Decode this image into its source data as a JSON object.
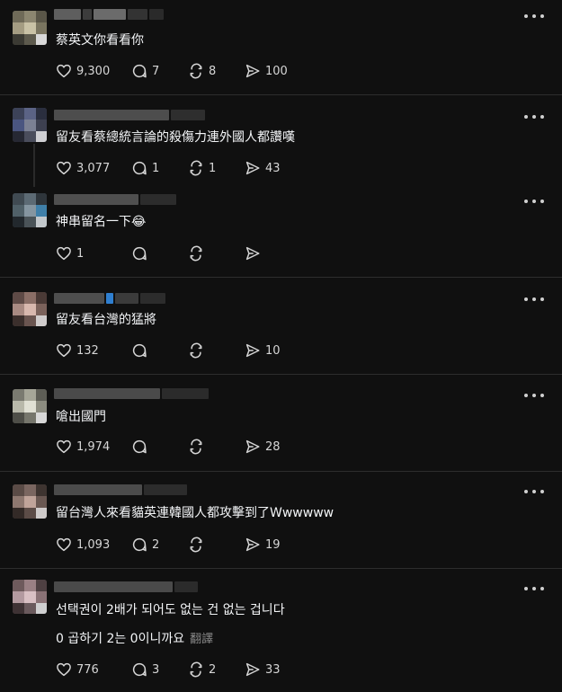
{
  "posts": [
    {
      "text": "蔡英文你看看你",
      "likes": "9,300",
      "comments": "7",
      "reposts": "8",
      "shares": "100"
    },
    {
      "text": "留友看蔡總統言論的殺傷力連外國人都讚嘆",
      "likes": "3,077",
      "comments": "1",
      "reposts": "1",
      "shares": "43"
    },
    {
      "text": "神串留名一下😂",
      "likes": "1",
      "comments": "",
      "reposts": "",
      "shares": ""
    },
    {
      "text": "留友看台灣的猛將",
      "likes": "132",
      "comments": "",
      "reposts": "",
      "shares": "10"
    },
    {
      "text": "嗆出國門",
      "likes": "1,974",
      "comments": "",
      "reposts": "",
      "shares": "28"
    },
    {
      "text": "留台灣人來看貓英連韓國人都攻擊到了Wwwwww",
      "likes": "1,093",
      "comments": "2",
      "reposts": "",
      "shares": "19"
    },
    {
      "text": "선택권이 2배가 되어도 없는 건 없는 겁니다",
      "text2": "0 곱하기 2는 0이니까요",
      "translate": "翻譯",
      "likes": "776",
      "comments": "3",
      "reposts": "2",
      "shares": "33"
    }
  ],
  "icons": {
    "like": "heart-icon",
    "comment": "comment-bubble-icon",
    "repost": "repost-icon",
    "share": "send-icon",
    "more": "more-options-icon"
  },
  "colors": {
    "background": "#101010",
    "text": "#f3f5f7",
    "icon": "#d6d6d6",
    "divider": "#2d2d2d",
    "muted": "#8a8a8a"
  }
}
